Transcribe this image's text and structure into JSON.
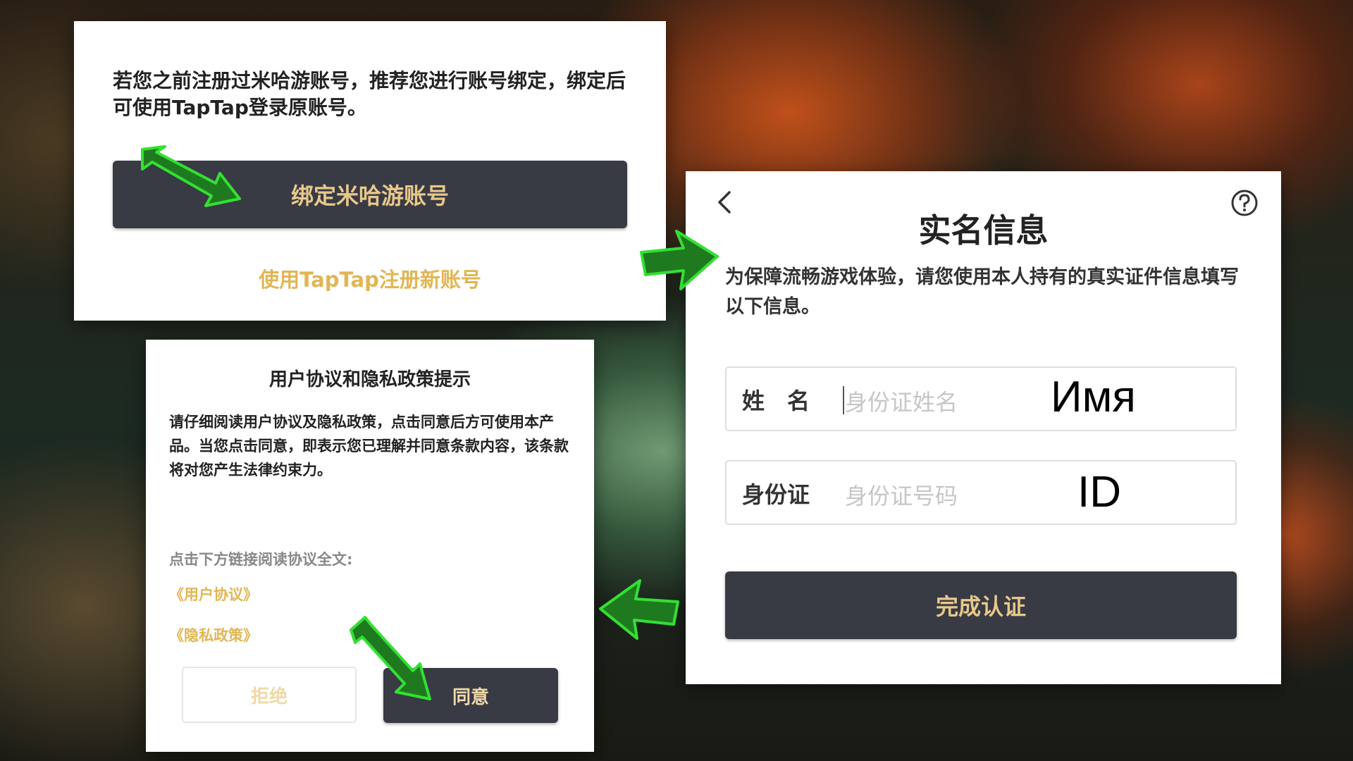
{
  "bind_panel": {
    "message": "若您之前注册过米哈游账号，推荐您进行账号绑定，绑定后可使用TapTap登录原账号。",
    "bind_button": "绑定米哈游账号",
    "register_link": "使用TapTap注册新账号"
  },
  "realname_panel": {
    "title": "实名信息",
    "description": "为保障流畅游戏体验，请您使用本人持有的真实证件信息填写以下信息。",
    "name_label": "姓　名",
    "name_placeholder": "身份证姓名",
    "name_annotation": "Имя",
    "id_label": "身份证",
    "id_placeholder": "身份证号码",
    "id_annotation": "ID",
    "submit_button": "完成认证",
    "back_icon": "chevron-left-icon",
    "help_icon": "question-circle-icon"
  },
  "agreement_panel": {
    "title": "用户协议和隐私政策提示",
    "body": "请仔细阅读用户协议及隐私政策，点击同意后方可使用本产品。当您点击同意，即表示您已理解并同意条款内容，该条款将对您产生法律约束力。",
    "link_prompt": "点击下方链接阅读协议全文:",
    "user_agreement_link": "《用户协议》",
    "privacy_policy_link": "《隐私政策》",
    "reject_button": "拒绝",
    "accept_button": "同意"
  },
  "colors": {
    "accent_gold": "#e2b553",
    "button_dark": "#383a44",
    "arrow_green": "#2ecc2e"
  }
}
